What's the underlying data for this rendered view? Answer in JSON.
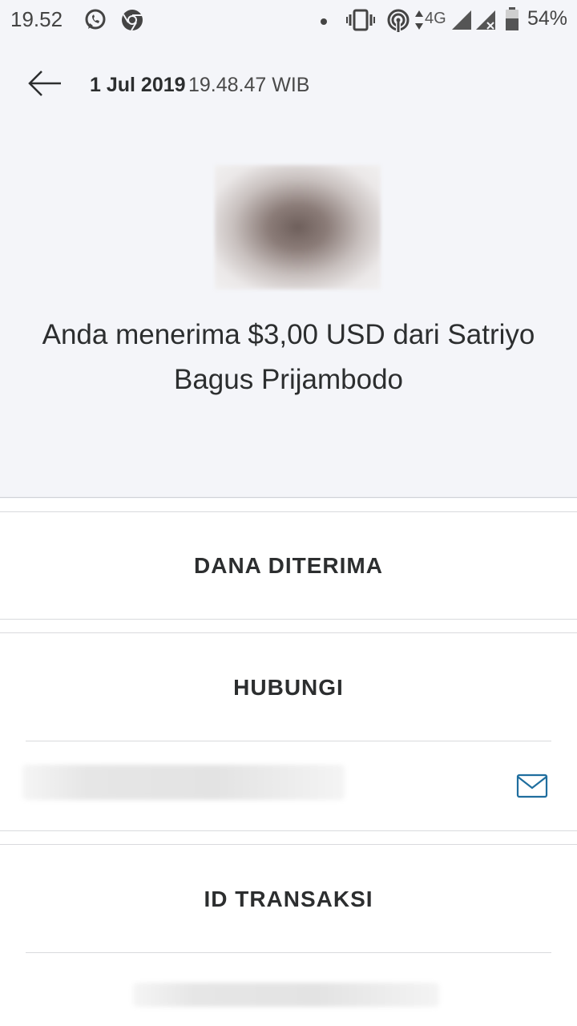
{
  "status_bar": {
    "time": "19.52",
    "network": "4G",
    "battery": "54%",
    "icons": [
      "whatsapp-icon",
      "chrome-icon",
      "dot-icon",
      "vibrate-icon",
      "hotspot-icon",
      "signal-icon",
      "signal-no-sim-icon",
      "battery-icon"
    ]
  },
  "header": {
    "date": "1 Jul 2019",
    "time": "19.48.47 WIB",
    "back_icon": "arrow-left-icon"
  },
  "transaction": {
    "headline": "Anda menerima $3,00 USD dari Satriyo Bagus Prijambodo"
  },
  "sections": {
    "status_label": "DANA DITERIMA",
    "contact_label": "HUBUNGI",
    "contact_icon": "envelope-icon",
    "transaction_id_label": "ID TRANSAKSI"
  },
  "colors": {
    "accent": "#1f6e9e",
    "background": "#f4f5f9",
    "text": "#2c2e2f"
  }
}
